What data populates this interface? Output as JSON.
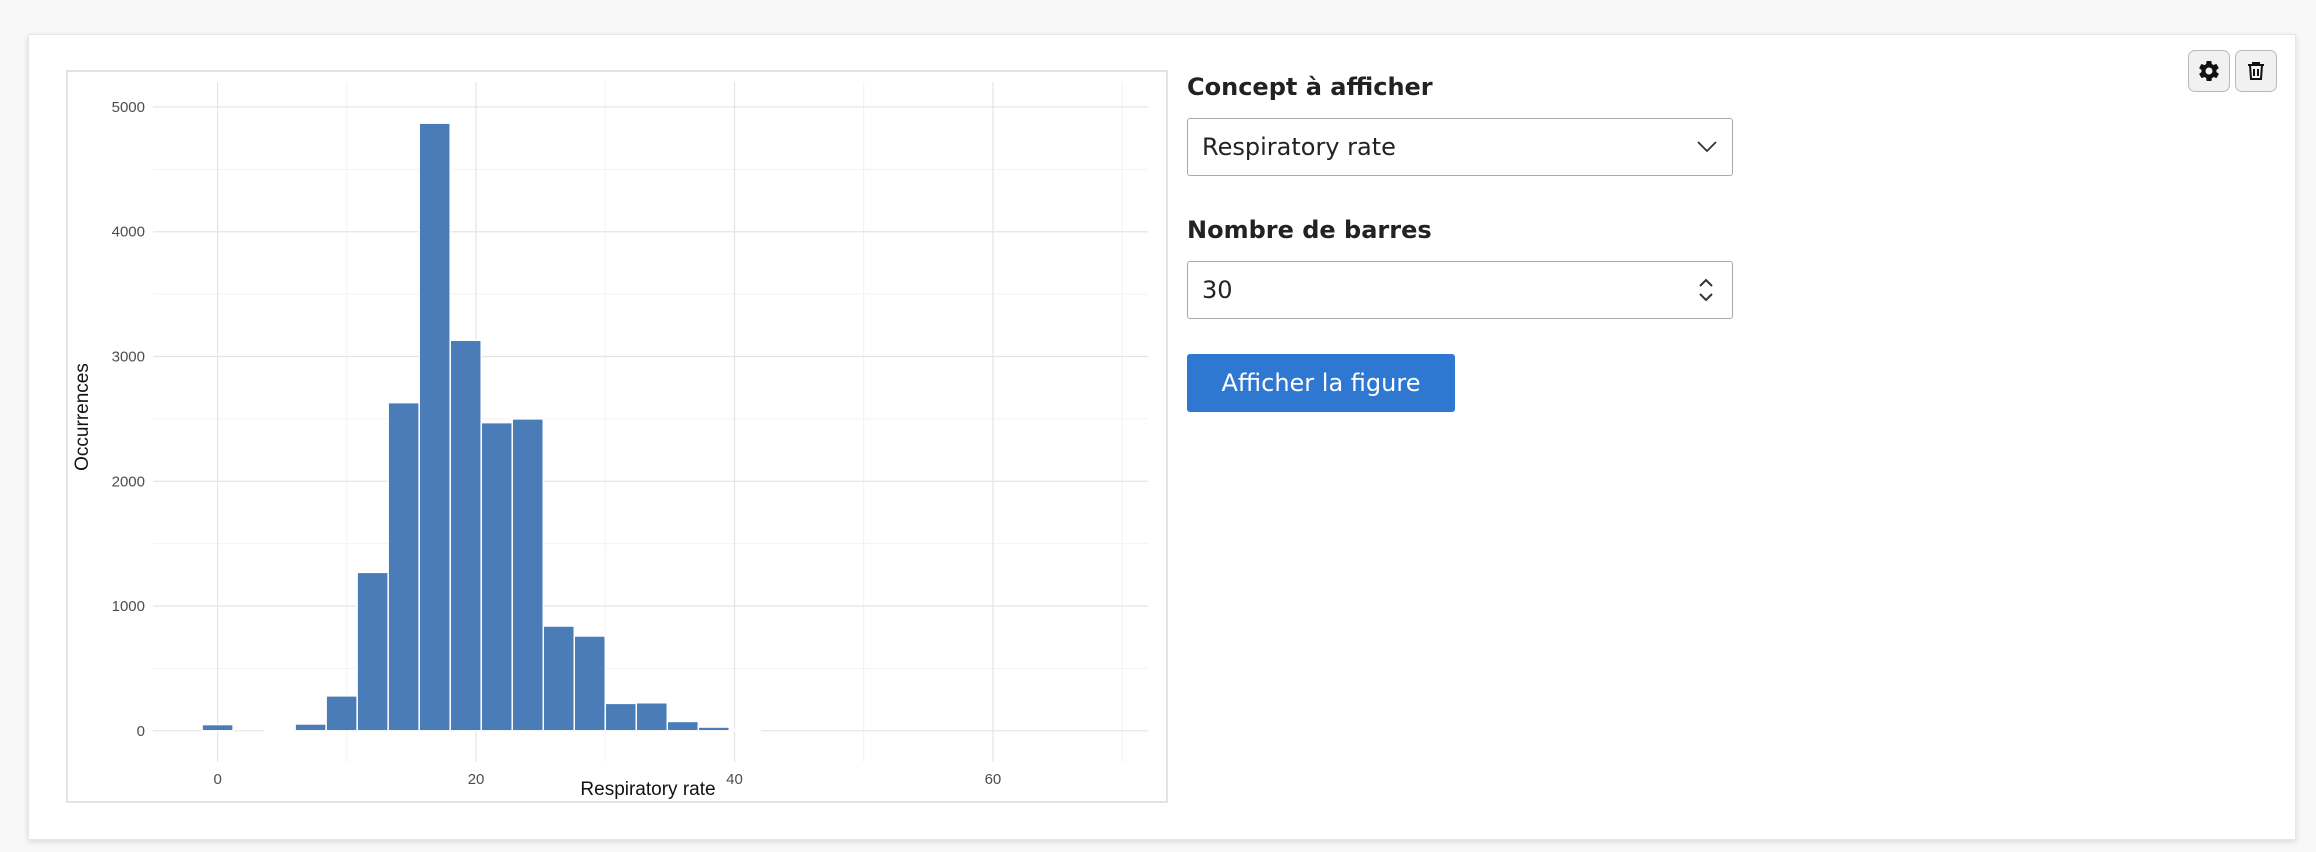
{
  "toolbar": {
    "settings_icon": "gear-icon",
    "delete_icon": "trash-icon"
  },
  "form": {
    "concept_label": "Concept à afficher",
    "concept_value": "Respiratory rate",
    "bars_label": "Nombre de barres",
    "bars_value": "30",
    "submit_label": "Afficher la figure"
  },
  "colors": {
    "bar_fill": "#4a7db8",
    "primary_button": "#2f78d2"
  },
  "chart_data": {
    "type": "bar",
    "title": "",
    "xlabel": "Respiratory rate",
    "ylabel": "Occurrences",
    "xlim": [
      -5,
      72
    ],
    "ylim": [
      -250,
      5200
    ],
    "x_ticks": [
      0,
      20,
      40,
      60
    ],
    "y_ticks": [
      0,
      1000,
      2000,
      3000,
      4000,
      5000
    ],
    "grid": true,
    "bin_width": 2.4,
    "bins": [
      {
        "x": 0.0,
        "count": 50
      },
      {
        "x": 4.8,
        "count": 10
      },
      {
        "x": 7.2,
        "count": 55
      },
      {
        "x": 9.6,
        "count": 280
      },
      {
        "x": 12.0,
        "count": 1270
      },
      {
        "x": 14.4,
        "count": 2630
      },
      {
        "x": 16.8,
        "count": 4870
      },
      {
        "x": 19.2,
        "count": 3130
      },
      {
        "x": 21.6,
        "count": 2470
      },
      {
        "x": 24.0,
        "count": 2500
      },
      {
        "x": 26.4,
        "count": 840
      },
      {
        "x": 28.8,
        "count": 760
      },
      {
        "x": 31.2,
        "count": 220
      },
      {
        "x": 33.6,
        "count": 225
      },
      {
        "x": 36.0,
        "count": 75
      },
      {
        "x": 38.4,
        "count": 30
      },
      {
        "x": 40.8,
        "count": 10
      }
    ]
  }
}
